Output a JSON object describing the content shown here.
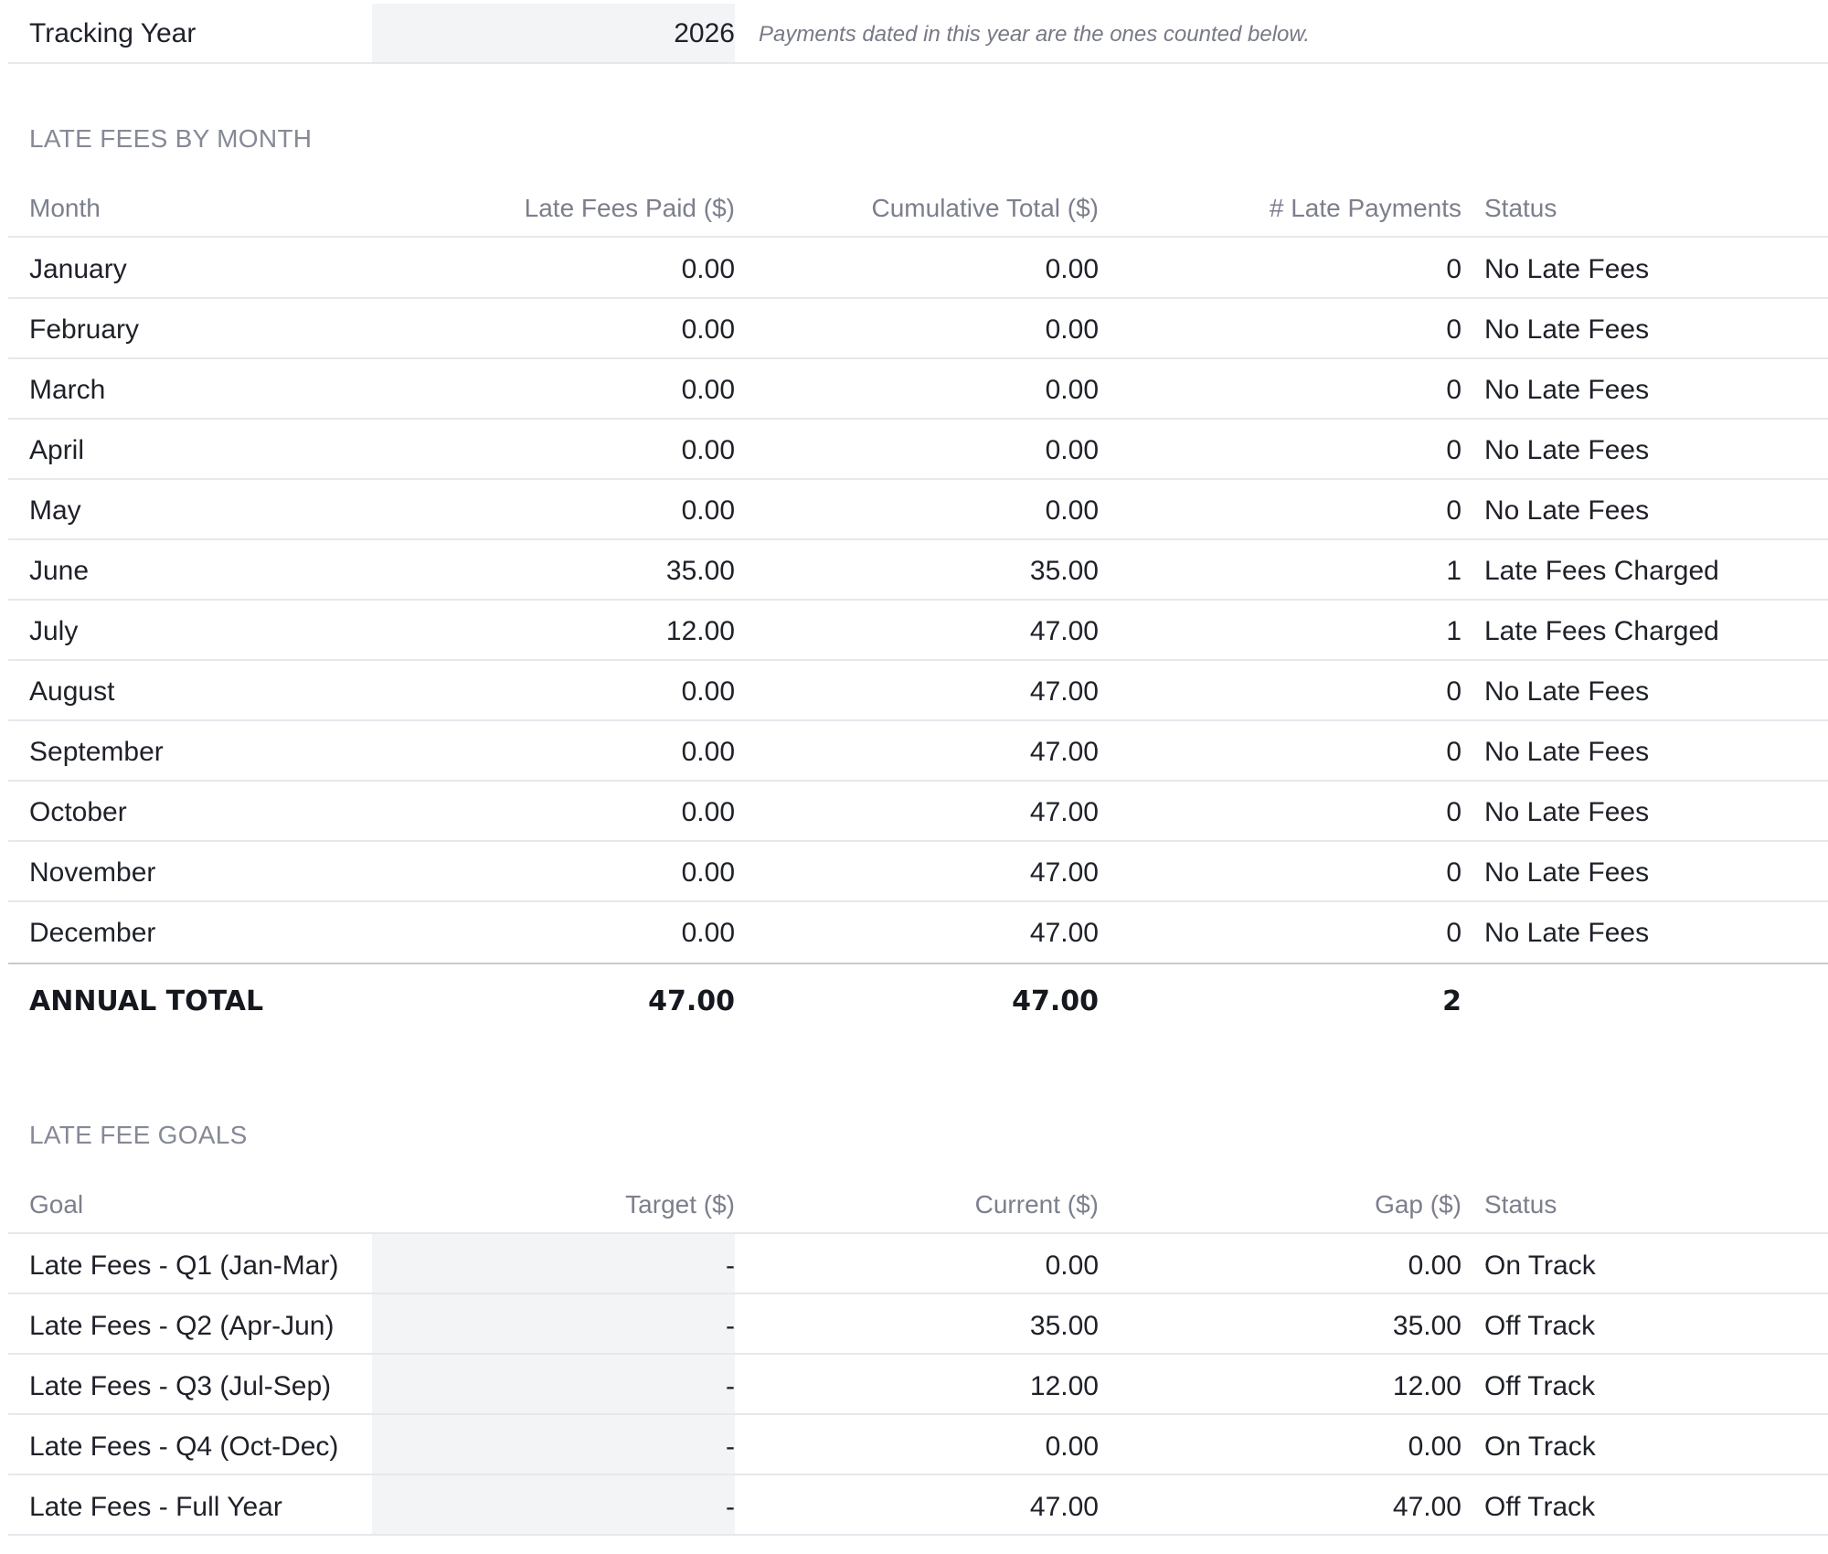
{
  "tracking": {
    "label": "Tracking Year",
    "year": "2026",
    "note": "Payments dated in this year are the ones counted below."
  },
  "monthly": {
    "title": "LATE FEES BY MONTH",
    "headers": [
      "Month",
      "Late Fees Paid ($)",
      "Cumulative Total ($)",
      "# Late Payments",
      "Status"
    ],
    "rows": [
      [
        "January",
        "0.00",
        "0.00",
        "0",
        "No Late Fees"
      ],
      [
        "February",
        "0.00",
        "0.00",
        "0",
        "No Late Fees"
      ],
      [
        "March",
        "0.00",
        "0.00",
        "0",
        "No Late Fees"
      ],
      [
        "April",
        "0.00",
        "0.00",
        "0",
        "No Late Fees"
      ],
      [
        "May",
        "0.00",
        "0.00",
        "0",
        "No Late Fees"
      ],
      [
        "June",
        "35.00",
        "35.00",
        "1",
        "Late Fees Charged"
      ],
      [
        "July",
        "12.00",
        "47.00",
        "1",
        "Late Fees Charged"
      ],
      [
        "August",
        "0.00",
        "47.00",
        "0",
        "No Late Fees"
      ],
      [
        "September",
        "0.00",
        "47.00",
        "0",
        "No Late Fees"
      ],
      [
        "October",
        "0.00",
        "47.00",
        "0",
        "No Late Fees"
      ],
      [
        "November",
        "0.00",
        "47.00",
        "0",
        "No Late Fees"
      ],
      [
        "December",
        "0.00",
        "47.00",
        "0",
        "No Late Fees"
      ]
    ],
    "total": [
      "ANNUAL TOTAL",
      "47.00",
      "47.00",
      "2",
      ""
    ]
  },
  "goals": {
    "title": "LATE FEE GOALS",
    "headers": [
      "Goal",
      "Target ($)",
      "Current ($)",
      "Gap ($)",
      "Status"
    ],
    "rows": [
      [
        "Late Fees - Q1 (Jan-Mar)",
        "-",
        "0.00",
        "0.00",
        "On Track"
      ],
      [
        "Late Fees - Q2 (Apr-Jun)",
        "-",
        "35.00",
        "35.00",
        "Off Track"
      ],
      [
        "Late Fees - Q3 (Jul-Sep)",
        "-",
        "12.00",
        "12.00",
        "Off Track"
      ],
      [
        "Late Fees - Q4 (Oct-Dec)",
        "-",
        "0.00",
        "0.00",
        "On Track"
      ],
      [
        "Late Fees - Full Year",
        "-",
        "47.00",
        "47.00",
        "Off Track"
      ]
    ]
  }
}
